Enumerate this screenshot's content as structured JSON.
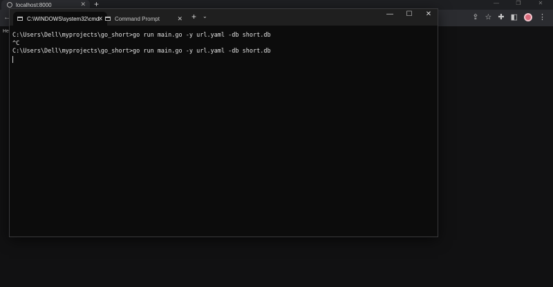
{
  "browser": {
    "tab_title": "localhost:8000",
    "tab_close": "✕",
    "new_tab": "+",
    "window_controls": [
      "—",
      "❐",
      "✕"
    ],
    "page_text": "He"
  },
  "terminal": {
    "tabs": [
      {
        "title": "C:\\WINDOWS\\system32\\cmd.",
        "close": "✕"
      },
      {
        "title": "Command Prompt",
        "close": "✕"
      }
    ],
    "new_tab": "+",
    "dropdown": "⌄",
    "window_controls": [
      "—",
      "☐",
      "✕"
    ],
    "lines": [
      "C:\\Users\\Dell\\myprojects\\go_short>go run main.go -y url.yaml -db short.db",
      "^C",
      "C:\\Users\\Dell\\myprojects\\go_short>go run main.go -y url.yaml -db short.db"
    ]
  }
}
